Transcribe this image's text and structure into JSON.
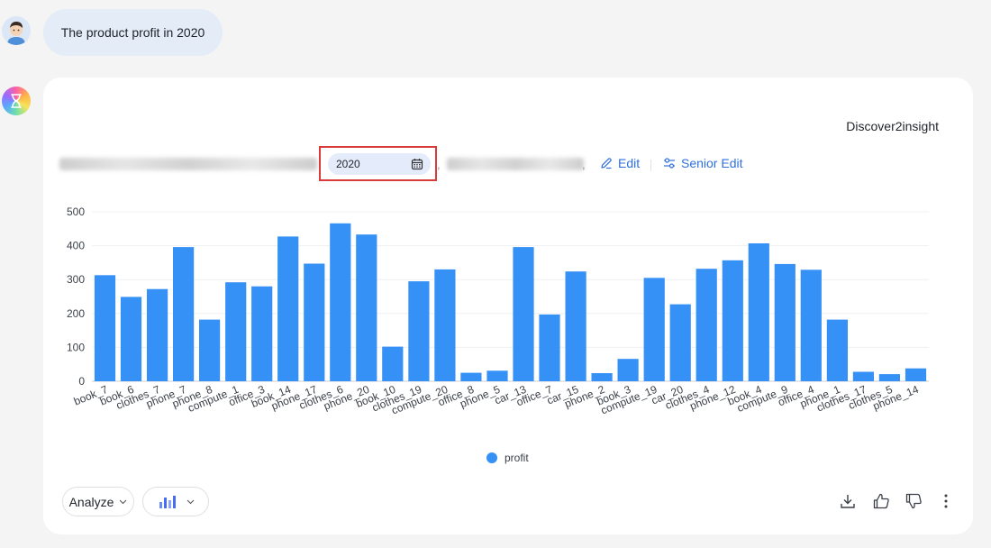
{
  "conversation": {
    "user_message": "The product profit in 2020",
    "brand": "Discover2insight"
  },
  "query_bar": {
    "date_value": "2020",
    "comma": ",",
    "edit_label": "Edit",
    "senior_edit_label": "Senior Edit"
  },
  "toolbar": {
    "analyze_label": "Analyze"
  },
  "legend": {
    "series_label": "profit"
  },
  "colors": {
    "bar": "#3591f5",
    "accent": "#2e6fe0",
    "highlight_border": "#d93a3a"
  },
  "chart_data": {
    "type": "bar",
    "categories": [
      "book_7",
      "book_6",
      "clothes_7",
      "phone_7",
      "phone_8",
      "compute_1",
      "office_3",
      "book_14",
      "phone_17",
      "clothes_6",
      "phone_20",
      "book_10",
      "clothes_19",
      "compute_20",
      "office_8",
      "phone_5",
      "car_13",
      "office_7",
      "car_15",
      "phone_2",
      "book_3",
      "compute_19",
      "car_20",
      "clothes_4",
      "phone_12",
      "book_4",
      "compute_9",
      "office_4",
      "phone_1",
      "clothes_17",
      "clothes_5",
      "phone_14"
    ],
    "series": [
      {
        "name": "profit",
        "values": [
          313,
          249,
          272,
          396,
          182,
          292,
          280,
          427,
          347,
          466,
          433,
          102,
          295,
          330,
          25,
          31,
          396,
          197,
          324,
          24,
          66,
          305,
          227,
          332,
          357,
          407,
          346,
          329,
          182,
          28,
          21,
          38
        ]
      }
    ],
    "yticks": [
      0,
      100,
      200,
      300,
      400,
      500
    ],
    "ylim": [
      0,
      500
    ],
    "grid": true,
    "legend_position": "bottom-center"
  }
}
